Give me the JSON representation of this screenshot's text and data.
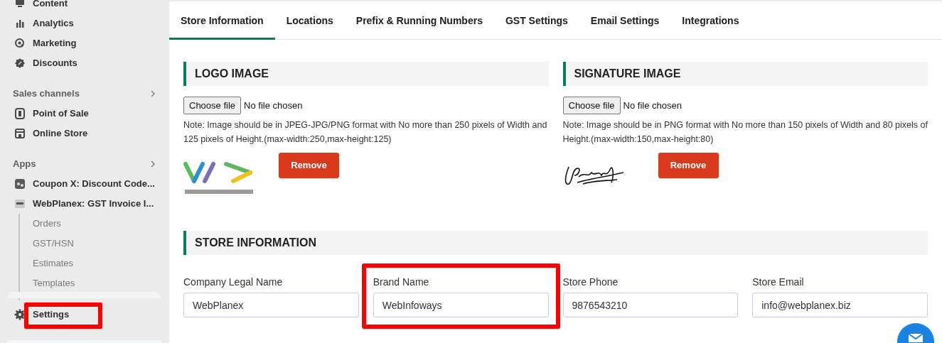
{
  "sidebar": {
    "items": [
      {
        "kind": "item",
        "label": "Content"
      },
      {
        "kind": "item",
        "label": "Analytics"
      },
      {
        "kind": "item",
        "label": "Marketing"
      },
      {
        "kind": "item",
        "label": "Discounts"
      },
      {
        "kind": "heading",
        "label": "Sales channels"
      },
      {
        "kind": "item",
        "label": "Point of Sale"
      },
      {
        "kind": "item",
        "label": "Online Store"
      },
      {
        "kind": "heading",
        "label": "Apps"
      },
      {
        "kind": "item",
        "label": "Coupon X: Discount Code..."
      },
      {
        "kind": "item",
        "label": "WebPlanex: GST Invoice I...",
        "children": [
          {
            "label": "Orders"
          },
          {
            "label": "GST/HSN"
          },
          {
            "label": "Estimates"
          },
          {
            "label": "Templates"
          }
        ]
      }
    ],
    "settings": {
      "label": "Settings",
      "highlighted": true
    }
  },
  "tabs": [
    {
      "label": "Store Information",
      "selected": true
    },
    {
      "label": "Locations",
      "selected": false
    },
    {
      "label": "Prefix & Running Numbers",
      "selected": false
    },
    {
      "label": "GST Settings",
      "selected": false
    },
    {
      "label": "Email Settings",
      "selected": false
    },
    {
      "label": "Integrations",
      "selected": false
    }
  ],
  "image_sections": [
    {
      "title": "LOGO IMAGE",
      "file_button": "Choose file",
      "file_status": "No file chosen",
      "note": "Note: Image should be in JPEG-JPG/PNG format with No more than 250 pixels of Width and 125 pixels of Height.(max-width:250,max-height:125)",
      "remove": "Remove"
    },
    {
      "title": "SIGNATURE IMAGE",
      "file_button": "Choose file",
      "file_status": "No file chosen",
      "note": "Note: Image should be in PNG format with No more than 150 pixels of Width and 80 pixels of Height.(max-width:150,max-height:80)",
      "remove": "Remove"
    }
  ],
  "store_information": {
    "title": "STORE INFORMATION",
    "fields": [
      {
        "label": "Company Legal Name",
        "value": "WebPlanex",
        "highlighted": false
      },
      {
        "label": "Brand Name",
        "value": "WebInfoways",
        "highlighted": true
      },
      {
        "label": "Store Phone",
        "value": "9876543210",
        "highlighted": false
      },
      {
        "label": "Store Email",
        "value": "info@webplanex.biz",
        "highlighted": false
      }
    ]
  }
}
